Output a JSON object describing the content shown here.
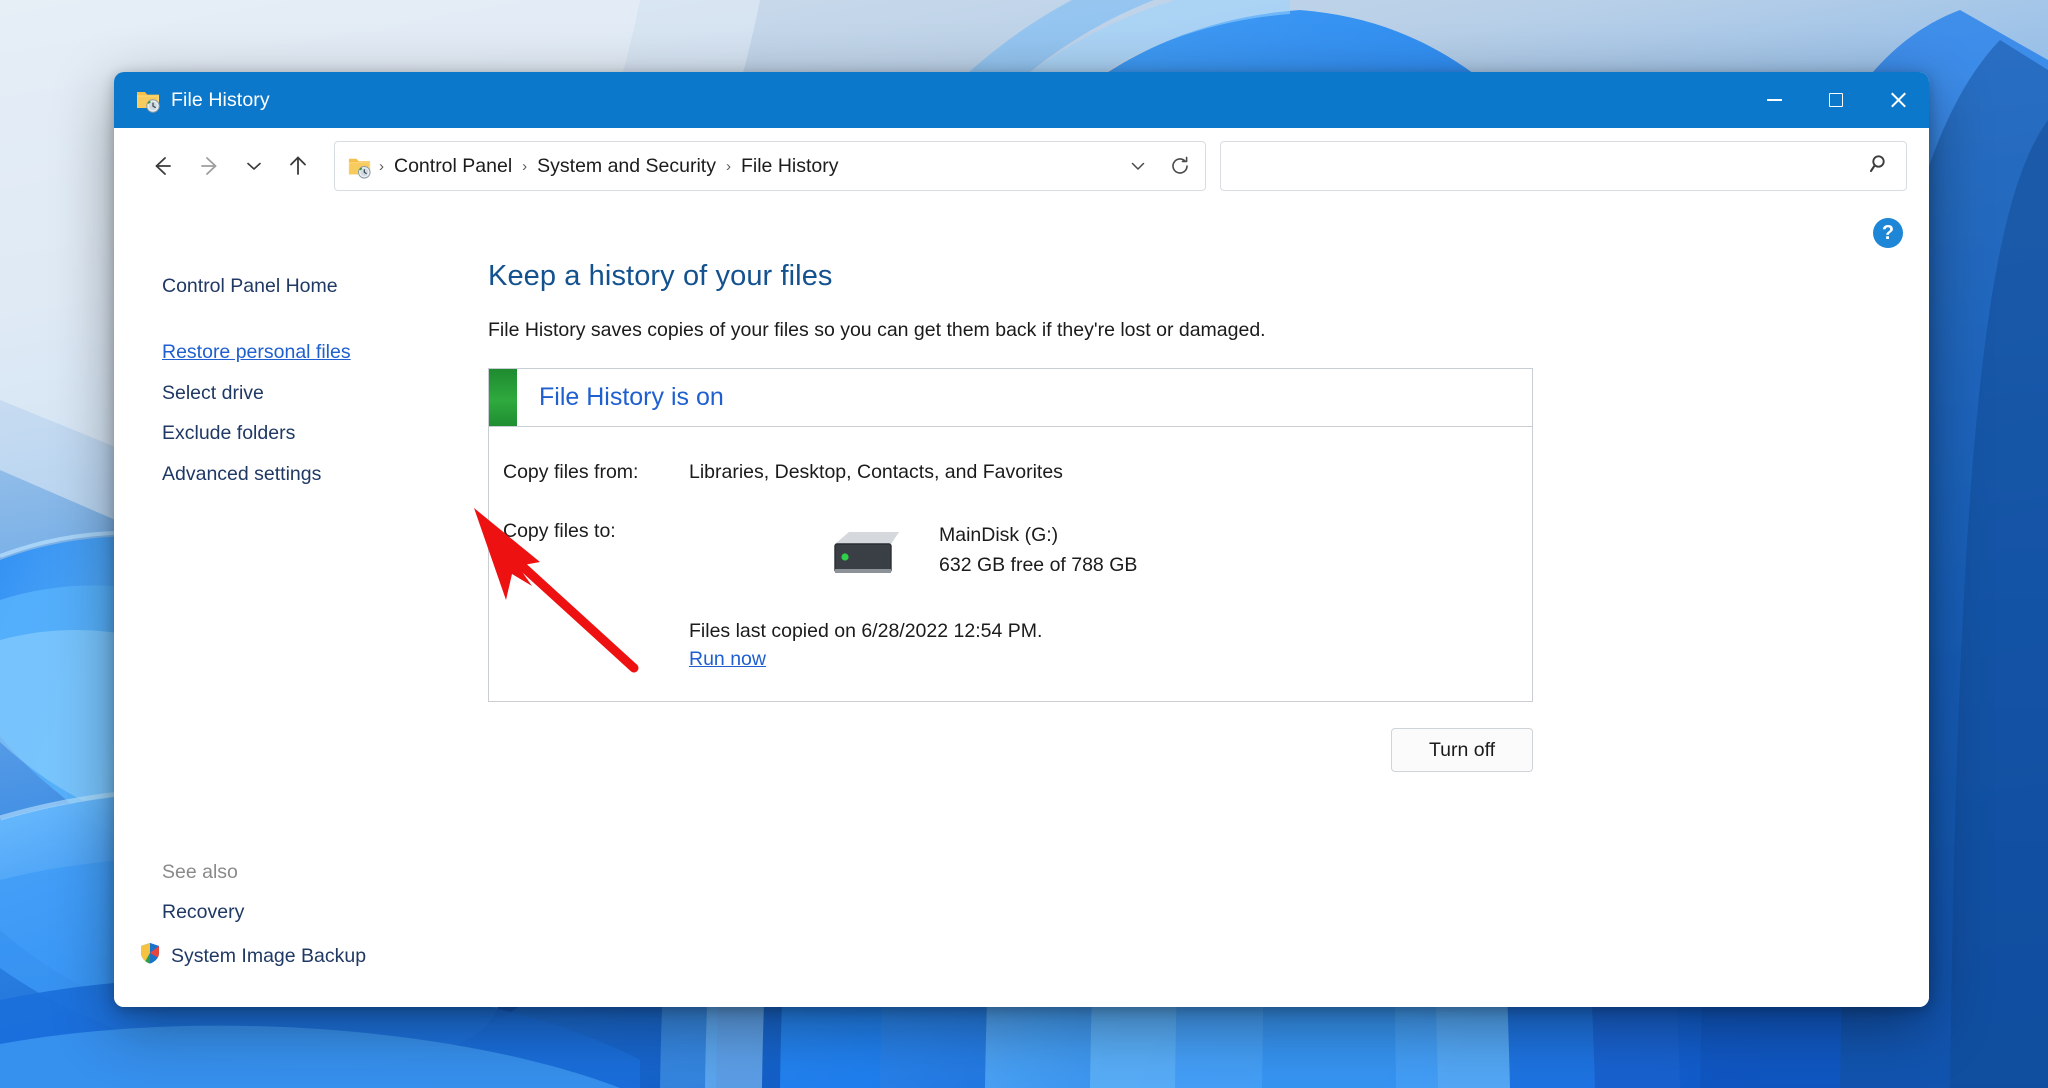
{
  "window": {
    "title": "File History",
    "icon": "folder-history-icon",
    "controls": {
      "minimize": "Minimize",
      "maximize": "Maximize",
      "close": "Close"
    },
    "titlebar_color": "#0b78cc"
  },
  "navbar": {
    "back": "Back",
    "forward": "Forward",
    "recent": "Recent locations",
    "up": "Up",
    "breadcrumb": {
      "icon": "folder-history-icon",
      "items": [
        "Control Panel",
        "System and Security",
        "File History"
      ],
      "separator": "›"
    },
    "dropdown": "Previous locations",
    "refresh": "Refresh",
    "search": {
      "value": "",
      "placeholder": "",
      "icon": "search-icon"
    }
  },
  "sidebar": {
    "home": "Control Panel Home",
    "items": [
      {
        "label": "Restore personal files",
        "active": true
      },
      {
        "label": "Select drive",
        "active": false
      },
      {
        "label": "Exclude folders",
        "active": false
      },
      {
        "label": "Advanced settings",
        "active": false
      }
    ],
    "see_also_label": "See also",
    "see_also_items": [
      {
        "label": "Recovery",
        "icon": null
      },
      {
        "label": "System Image Backup",
        "icon": "shield-icon"
      }
    ]
  },
  "content": {
    "title": "Keep a history of your files",
    "description": "File History saves copies of your files so you can get them back if they're lost or damaged.",
    "status": {
      "indicator_color": "#2faa3e",
      "title": "File History is on",
      "rows": [
        {
          "label": "Copy files from:",
          "value": "Libraries, Desktop, Contacts, and Favorites"
        },
        {
          "label": "Copy files to:",
          "value": ""
        }
      ],
      "drive": {
        "icon": "external-drive-icon",
        "name": "MainDisk (G:)",
        "capacity": "632 GB free of 788 GB"
      },
      "last_copied": "Files last copied on 6/28/2022 12:54 PM.",
      "run_now": "Run now"
    },
    "turn_off_button": "Turn off",
    "help_button": "?"
  },
  "annotation": {
    "type": "red-arrow",
    "color": "#ee1111",
    "points_at": "Restore personal files"
  }
}
